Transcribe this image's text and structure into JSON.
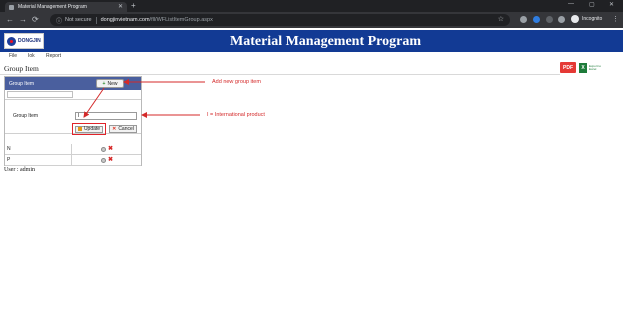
{
  "browser": {
    "tab_title": "Material Management Program",
    "tab_close": "✕",
    "new_tab": "+",
    "security_label": "Not secure",
    "url_host": "dongjinvietnam.com",
    "url_path": "/fll/WFListItemGroup.aspx",
    "profile_label": "Incognito",
    "nav_back": "←",
    "nav_forward": "→",
    "nav_reload": "⟳",
    "win_min": "—",
    "win_max": "▢",
    "win_close": "✕"
  },
  "app": {
    "logo_text": "DONGJIN",
    "title": "Material Management Program",
    "menu": [
      "File",
      "Iok",
      "Report"
    ],
    "page_heading": "Group Item",
    "user_line": "User : admin"
  },
  "export": {
    "pdf_label": "PDF",
    "xls_label": "X",
    "xls_caption": "Export to Excel"
  },
  "grid": {
    "header_label": "Group Item",
    "new_button": "New",
    "edit_label": "Group Item",
    "edit_value": "I",
    "update_button": "Update",
    "cancel_button": "Cancel",
    "rows": [
      {
        "code": "N"
      },
      {
        "code": "P"
      }
    ]
  },
  "annotations": {
    "new_note": "Add new group item",
    "edit_note": "I = International product"
  },
  "colors": {
    "header_blue": "#123a94",
    "grid_header": "#4a5f9e",
    "annotation_red": "#d42a2a"
  }
}
